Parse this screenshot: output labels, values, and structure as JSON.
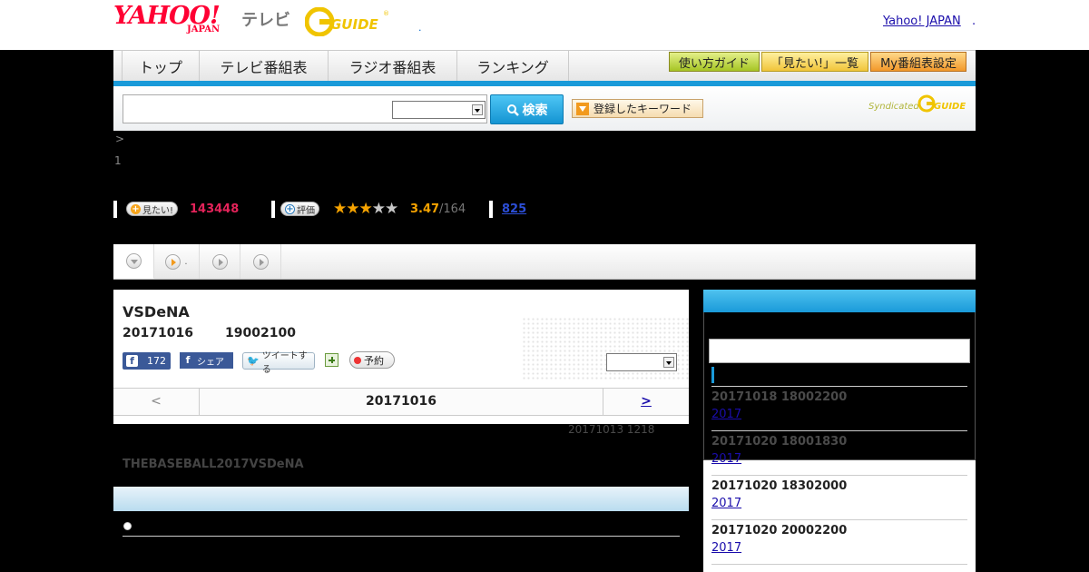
{
  "header": {
    "logo_yahoo": "YAHOO!",
    "logo_japan": "JAPAN",
    "logo_tv": "テレビ",
    "logo_gguide": "GUIDE",
    "dot": ".",
    "yahoo_japan_link": "Yahoo! JAPAN",
    "yahoo_japan_link_tail": "."
  },
  "nav": {
    "tabs": [
      "トップ",
      "テレビ番組表",
      "ラジオ番組表",
      "ランキング"
    ],
    "right_buttons": [
      "使い方ガイド",
      "「見たい!」一覧",
      "My番組表設定"
    ]
  },
  "search": {
    "placeholder": "",
    "button_label": "検索",
    "keyword_button": "登録したキーワード",
    "syndicated": "Syndicated",
    "syndicated_logo": "GUIDE"
  },
  "breadcrumb": {
    "arrow": ">",
    "number": "1"
  },
  "stats": {
    "want_label": "見たい!",
    "want_count": "143448",
    "rate_label": "評価",
    "stars_on": 3,
    "stars_total": 5,
    "rating": "3.47",
    "rating_den": "/164",
    "reviews": "825"
  },
  "tabstrip": {
    "tab2_dot": "."
  },
  "program": {
    "title": "VSDeNA",
    "date": "20171016",
    "time": "19002100",
    "fb_like_count": "172",
    "fb_share": "シェア",
    "tweet": "ツイートする",
    "reserve": "予約",
    "pager_prev": "<",
    "pager_date": "20171016",
    "pager_next": ">",
    "updated": "20171013 1218",
    "description": "THEBASEBALL2017VSDeNA"
  },
  "sidebar": {
    "items": [
      {
        "date": "20171018 18002200",
        "link": "2017",
        "date_color": "#4a4a4a"
      },
      {
        "date": "20171020 18001830",
        "link": "2017",
        "date_color": "#4a4a4a"
      },
      {
        "date": "20171020 18302000",
        "link": "2017",
        "date_color": "#222222"
      },
      {
        "date": "20171020 20002200",
        "link": "2017",
        "date_color": "#222222"
      }
    ]
  },
  "colors": {
    "accent": "#1a9ad9",
    "want": "#e4235a",
    "star": "#f6a300",
    "link": "#1a0dab"
  }
}
